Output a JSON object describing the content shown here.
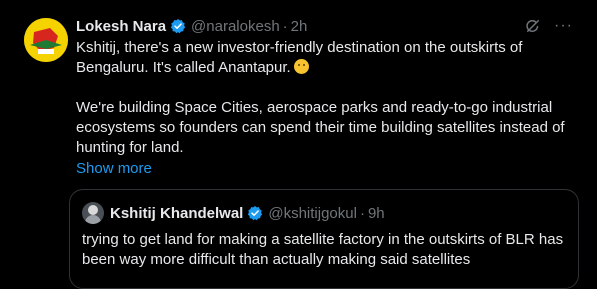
{
  "tweet": {
    "author_name": "Lokesh Nara",
    "author_handle": "@naralokesh",
    "separator": "·",
    "time": "2h",
    "more_label": "···",
    "paragraph1": "Kshitij, there's a new investor-friendly destination on the outskirts of Bengaluru. It's called Anantapur.",
    "paragraph2": "We're building Space Cities, aerospace parks and ready-to-go industrial ecosystems so founders can spend their time building satellites instead of hunting for land.",
    "show_more": "Show more"
  },
  "quote": {
    "author_name": "Kshitij Khandelwal",
    "author_handle": "@kshitijgokul",
    "separator": "·",
    "time": "9h",
    "text": "trying to get land for making a satellite factory in the outskirts of BLR has been way more difficult than actually making said satellites"
  },
  "icons": {
    "verified": "verified-badge-icon",
    "grok": "grok-icon",
    "more": "more-options-icon",
    "emoji": "smiling-emoji-icon"
  },
  "colors": {
    "background": "#000000",
    "text": "#e7e9ea",
    "secondary_text": "#71767b",
    "link": "#1d9bf0",
    "verified": "#1d9bf0",
    "quote_border": "#2f3336",
    "avatar_yellow": "#f5d300"
  }
}
